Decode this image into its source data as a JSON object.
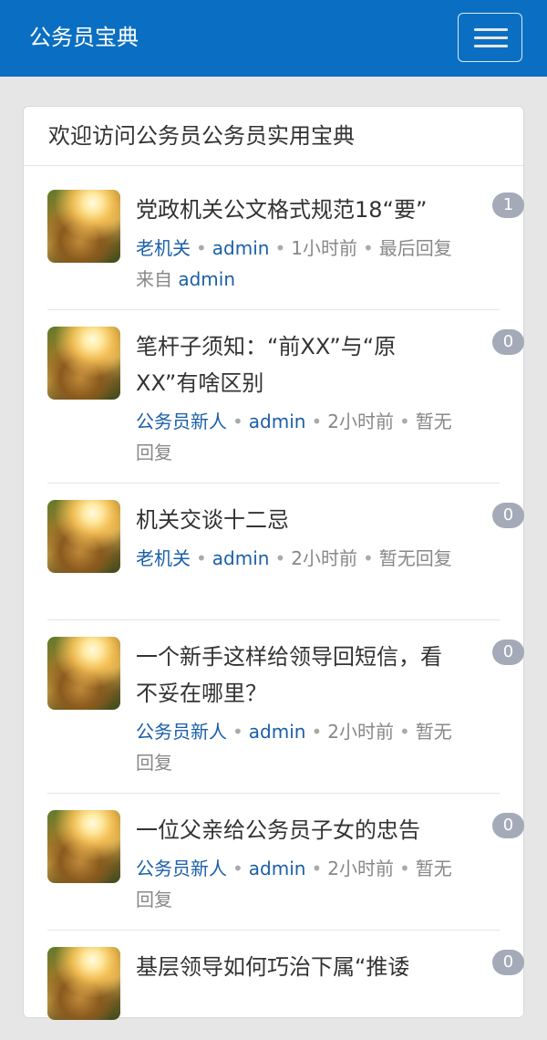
{
  "header": {
    "brand": "公务员宝典",
    "menu_icon": "hamburger-menu-icon"
  },
  "card": {
    "title": "欢迎访问公务员公务员实用宝典"
  },
  "topics": [
    {
      "title": "党政机关公文格式规范18“要”",
      "category": "老机关",
      "author": "admin",
      "time": "1小时前",
      "reply_prefix": "最后回复来自",
      "reply_user": "admin",
      "count": "1"
    },
    {
      "title": "笔杆子须知：“前XX”与“原XX”有啥区别",
      "category": "公务员新人",
      "author": "admin",
      "time": "2小时前",
      "reply_prefix": "暂无回复",
      "reply_user": "",
      "count": "0"
    },
    {
      "title": "机关交谈十二忌",
      "category": "老机关",
      "author": "admin",
      "time": "2小时前",
      "reply_prefix": "暂无回复",
      "reply_user": "",
      "count": "0"
    },
    {
      "title": "一个新手这样给领导回短信，看不妥在哪里？",
      "category": "公务员新人",
      "author": "admin",
      "time": "2小时前",
      "reply_prefix": "暂无回复",
      "reply_user": "",
      "count": "0"
    },
    {
      "title": "一位父亲给公务员子女的忠告",
      "category": "公务员新人",
      "author": "admin",
      "time": "2小时前",
      "reply_prefix": "暂无回复",
      "reply_user": "",
      "count": "0"
    },
    {
      "title": "基层领导如何巧治下属“推诿",
      "category": "",
      "author": "",
      "time": "",
      "reply_prefix": "",
      "reply_user": "",
      "count": "0"
    }
  ]
}
